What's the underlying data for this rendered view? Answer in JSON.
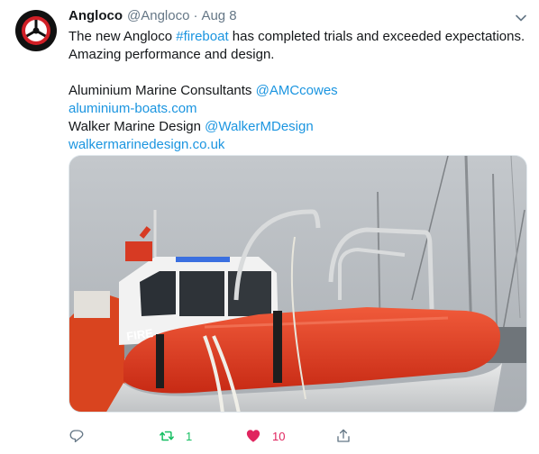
{
  "tweet": {
    "display_name": "Angloco",
    "handle": "@Angloco",
    "separator": "·",
    "time": "Aug 8",
    "text": {
      "line1_a": "The new Angloco ",
      "line1_hashtag": "#fireboat",
      "line1_b": " has completed trials and exceeded expectations.",
      "line2": "Amazing performance and design.",
      "line4_a": "Aluminium Marine Consultants ",
      "line4_mention": "@AMCcowes",
      "line5_link": "aluminium-boats.com",
      "line6_a": "Walker Marine Design ",
      "line6_mention": "@WalkerMDesign",
      "line7_link": "walkermarinedesign.co.uk"
    },
    "media": {
      "boat_label": "FIRE"
    },
    "actions": {
      "reply_icon": "reply-icon",
      "retweet_icon": "retweet-icon",
      "retweet_count": "1",
      "like_icon": "heart-icon",
      "like_count": "10",
      "share_icon": "share-icon"
    },
    "colors": {
      "link": "#1b95e0",
      "retweet_active": "#17bf63",
      "like_active": "#e0245e",
      "secondary_text": "#657786",
      "boat_red": "#e23a1f"
    }
  }
}
